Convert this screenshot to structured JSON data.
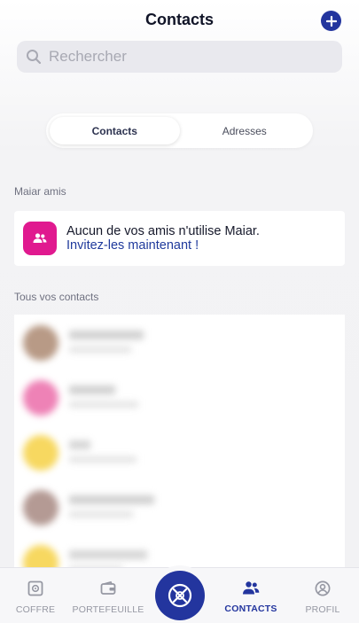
{
  "header": {
    "title": "Contacts",
    "add_icon": "plus-icon"
  },
  "search": {
    "placeholder": "Rechercher"
  },
  "segment": {
    "tabs": [
      {
        "label": "Contacts"
      },
      {
        "label": "Adresses"
      }
    ]
  },
  "sections": {
    "friends": "Maiar amis",
    "all_contacts": "Tous vos contacts"
  },
  "invite": {
    "line1": "Aucun de vos amis n'utilise Maiar.",
    "line2": "Invitez-les maintenant !",
    "icon": "people-icon"
  },
  "tabbar": {
    "items": [
      {
        "label": "COFFRE",
        "icon": "safe-icon"
      },
      {
        "label": "PORTEFEUILLE",
        "icon": "wallet-icon"
      },
      {
        "label": "CONTACTS",
        "icon": "contacts-icon"
      },
      {
        "label": "PROFIL",
        "icon": "profile-icon"
      }
    ],
    "center_icon": "maiar-logo-icon"
  },
  "colors": {
    "accent": "#23359e",
    "invite_icon_bg": "#e0198f",
    "avatars": [
      "#b89a86",
      "#ee82b6",
      "#f7d860",
      "#b49a94",
      "#f7d860"
    ]
  }
}
